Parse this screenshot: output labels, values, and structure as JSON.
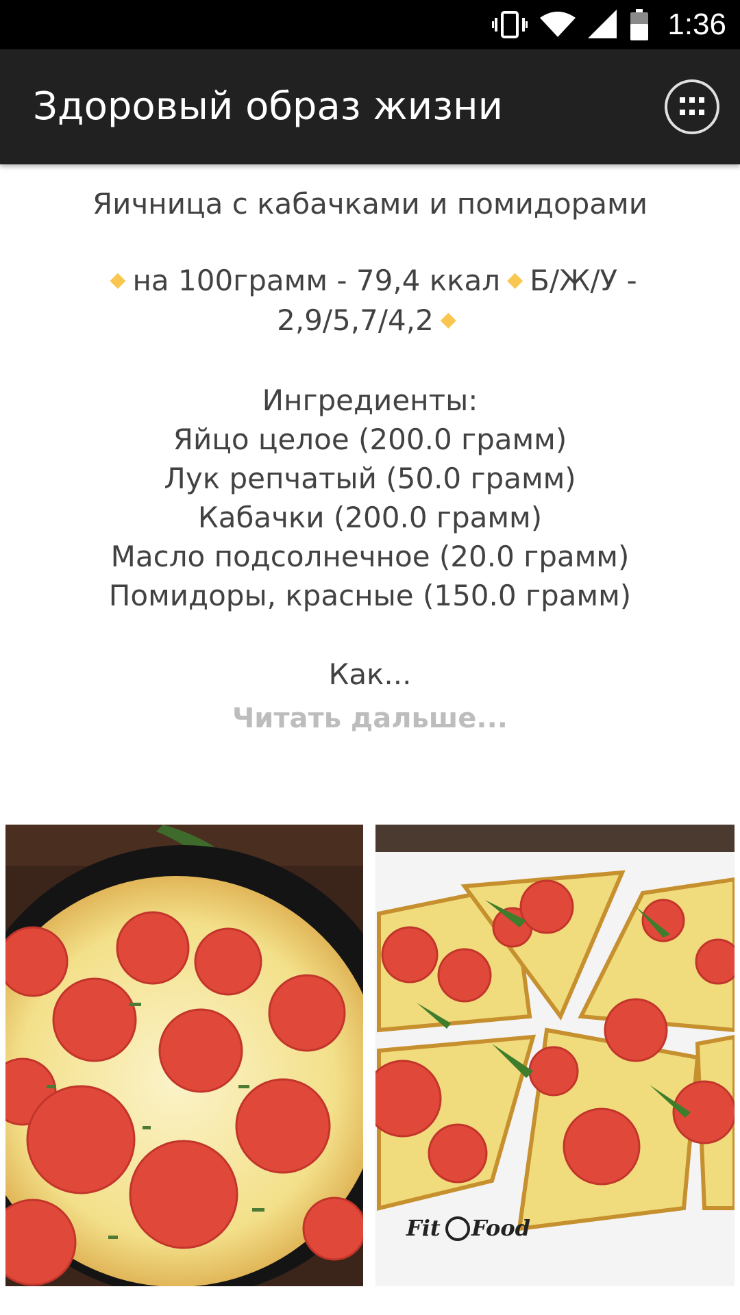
{
  "status_bar": {
    "time": "1:36",
    "icons": [
      "vibrate-icon",
      "wifi-icon",
      "signal-icon",
      "battery-icon"
    ]
  },
  "app_bar": {
    "title": "Здоровый образ жизни",
    "menu_icon": "apps-grid-icon"
  },
  "recipe": {
    "title": "Яичница с кабачками и помидорами",
    "calories": "на 100грамм - 79,4 ккал",
    "macros_label": "Б/Ж/У -",
    "macros_value": "2,9/5,7/4,2",
    "ingredients_heading": "Ингредиенты:",
    "ingredients": [
      "Яйцо целое (200.0 грамм)",
      "Лук репчатый (50.0 грамм)",
      "Кабачки (200.0 грамм)",
      "Масло подсолнечное (20.0 грамм)",
      "Помидоры, красные (150.0 грамм)"
    ],
    "method_preview": "Как...",
    "read_more": "Читать дальше..."
  },
  "photos": {
    "right_watermark_a": "Fit",
    "right_watermark_b": "Food"
  },
  "colors": {
    "status_bar": "#000000",
    "app_bar": "#212121",
    "text": "#424242",
    "read_more": "#bdbdbd",
    "bullet": "#f9c74f"
  }
}
